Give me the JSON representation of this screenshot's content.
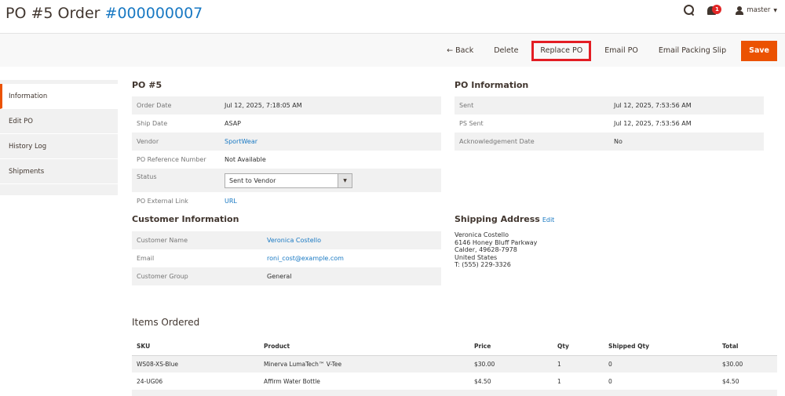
{
  "header": {
    "title_prefix": "PO #5 Order ",
    "title_link": "#000000007",
    "notifications_count": "1",
    "user": "master"
  },
  "actions": {
    "back": "← Back",
    "delete": "Delete",
    "replace": "Replace PO",
    "email_po": "Email PO",
    "email_slip": "Email Packing Slip",
    "save": "Save"
  },
  "tabs": [
    "Information",
    "Edit PO",
    "History Log",
    "Shipments"
  ],
  "po": {
    "title": "PO #5",
    "rows": {
      "order_date_label": "Order Date",
      "order_date": "Jul 12, 2025, 7:18:05 AM",
      "ship_date_label": "Ship Date",
      "ship_date": "ASAP",
      "vendor_label": "Vendor",
      "vendor": "SportWear",
      "ref_label": "PO Reference Number",
      "ref": "Not Available",
      "status_label": "Status",
      "status": "Sent to Vendor",
      "link_label": "PO External Link",
      "link": "URL"
    }
  },
  "po_info": {
    "title": "PO Information",
    "sent_label": "Sent",
    "sent": "Jul 12, 2025, 7:53:56 AM",
    "ps_sent_label": "PS Sent",
    "ps_sent": "Jul 12, 2025, 7:53:56 AM",
    "ack_label": "Acknowledgement Date",
    "ack": "No"
  },
  "customer": {
    "title": "Customer Information",
    "name_label": "Customer Name",
    "name": "Veronica Costello",
    "email_label": "Email",
    "email": "roni_cost@example.com",
    "group_label": "Customer Group",
    "group": "General"
  },
  "shipping": {
    "title": "Shipping Address",
    "edit": "Edit",
    "lines": [
      "Veronica Costello",
      "6146 Honey Bluff Parkway",
      "Calder, 49628-7978",
      "United States",
      "T: (555) 229-3326"
    ]
  },
  "items": {
    "title": "Items Ordered",
    "columns": [
      "SKU",
      "Product",
      "Price",
      "Qty",
      "Shipped Qty",
      "Total"
    ],
    "rows": [
      [
        "WS08-XS-Blue",
        "Minerva LumaTech™ V-Tee",
        "$30.00",
        "1",
        "0",
        "$30.00"
      ],
      [
        "24-UG06",
        "Affirm Water Bottle",
        "$4.50",
        "1",
        "0",
        "$4.50"
      ]
    ]
  }
}
